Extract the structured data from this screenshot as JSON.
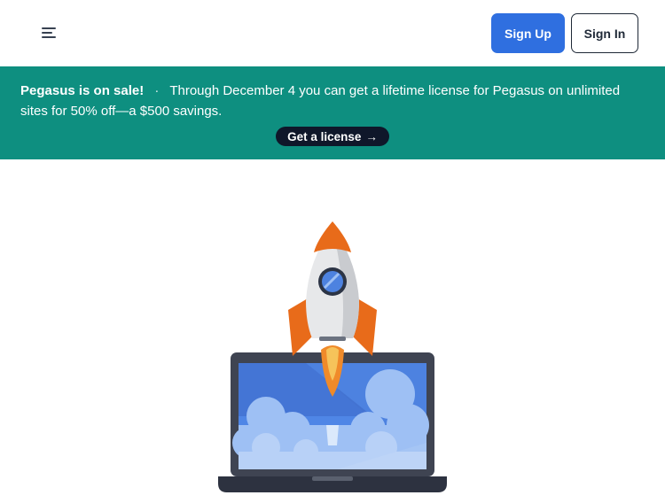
{
  "header": {
    "menu_icon": "hamburger-menu-icon",
    "signup_label": "Sign Up",
    "signin_label": "Sign In",
    "colors": {
      "primary": "#2f6fe0",
      "dark": "#1f2937"
    }
  },
  "banner": {
    "title": "Pegasus is on sale!",
    "separator": "·",
    "message": "Through December 4 you can get a lifetime license for Pegasus on unlimited sites for 50% off—a $500 savings.",
    "cta_label": "Get a license",
    "cta_arrow": "→",
    "background": "#0e8f80"
  },
  "hero": {
    "illustration": "rocket-launch-from-laptop-illustration"
  }
}
